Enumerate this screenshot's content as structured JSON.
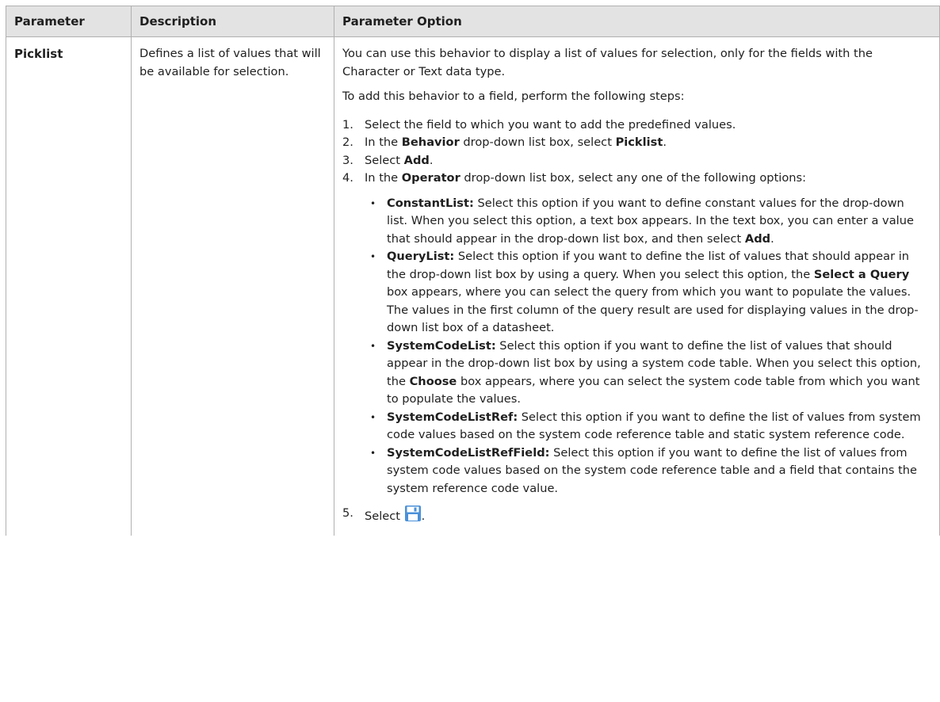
{
  "headers": {
    "parameter": "Parameter",
    "description": "Description",
    "option": "Parameter Option"
  },
  "row": {
    "parameter": "Picklist",
    "description": "Defines a list of values that will be available for selection.",
    "intro": "You can use this behavior to display a list of values for selection, only for the fields with the Character or Text data type.",
    "steps_intro": "To add this behavior to a field, perform the following steps:",
    "steps": [
      {
        "num": "1.",
        "text": "Select the field to which you want to add the predefined values."
      },
      {
        "num": "2.",
        "pre": "In the ",
        "b1": "Behavior",
        "mid": " drop-down list box, select ",
        "b2": "Picklist",
        "post": "."
      },
      {
        "num": "3.",
        "pre": "Select ",
        "b1": "Add",
        "post": "."
      },
      {
        "num": "4.",
        "pre": "In the ",
        "b1": "Operator",
        "post": " drop-down list box, select any one of the following options:"
      },
      {
        "num": "5.",
        "pre": "Select ",
        "post": "."
      }
    ],
    "options": [
      {
        "name": "ConstantList:",
        "text": " Select this option if you want to define constant values for the drop-down list. When you select this option, a text box appears. In the text box, you can enter a value that should appear in the drop-down list box, and then select ",
        "bold": "Add",
        "post": "."
      },
      {
        "name": "QueryList:",
        "text": " Select this option if you want to define the list of values that should appear in the drop-down list box by using a query. When you select this option, the ",
        "bold": "Select a Query",
        "post": " box appears, where you can select the query from which you want to populate the values. The values in the first column of the query result are used for displaying values in the drop-down list box of a datasheet."
      },
      {
        "name": "SystemCodeList:",
        "text": " Select this option if you want to define the list of values that should appear in the drop-down list box by using a system code table. When you select this option, the ",
        "bold": "Choose",
        "post": " box appears, where you can select the system code table from which you want to populate the values."
      },
      {
        "name": "SystemCodeListRef:",
        "text": " Select this option if you want to define the list of values from system code values based on the system code reference table and static system reference code."
      },
      {
        "name": "SystemCodeListRefField:",
        "text": " Select this option if you want to define the list of values from system code values based on the system code reference table and a field that contains the system reference code value."
      }
    ],
    "bullet": "•",
    "save_icon": "save-icon",
    "icon_color": "#4a90d9"
  }
}
